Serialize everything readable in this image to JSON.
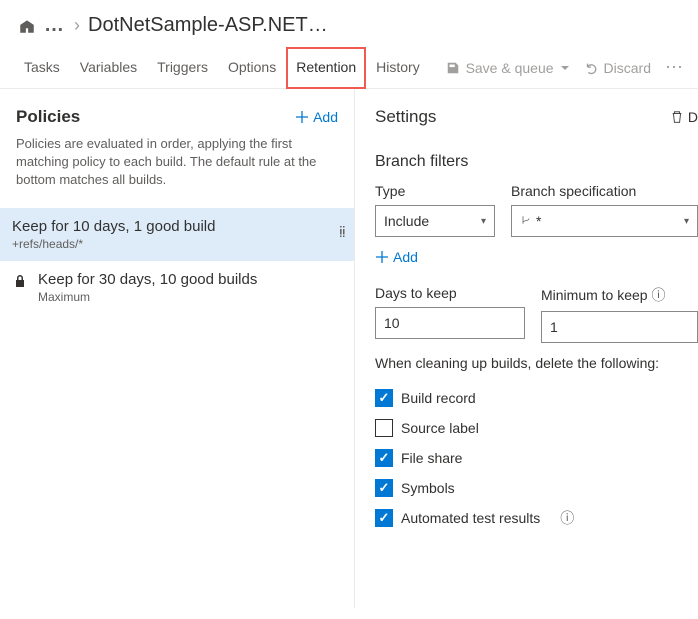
{
  "breadcrumb": {
    "ellipsis": "…",
    "title": "DotNetSample-ASP.NET…"
  },
  "tabs": {
    "tasks": "Tasks",
    "variables": "Variables",
    "triggers": "Triggers",
    "options": "Options",
    "retention": "Retention",
    "history": "History"
  },
  "toolbar": {
    "save_queue": "Save & queue",
    "discard": "Discard"
  },
  "policies": {
    "heading": "Policies",
    "add": "Add",
    "description": "Policies are evaluated in order, applying the first matching policy to each build. The default rule at the bottom matches all builds.",
    "items": [
      {
        "title": "Keep for 10 days, 1 good build",
        "sub": "+refs/heads/*"
      },
      {
        "title": "Keep for 30 days, 10 good builds",
        "sub": "Maximum"
      }
    ]
  },
  "settings": {
    "heading": "Settings",
    "delete_label": "D",
    "branch_filters": "Branch filters",
    "type_label": "Type",
    "type_value": "Include",
    "branch_spec_label": "Branch specification",
    "branch_spec_value": "*",
    "add": "Add",
    "days_label": "Days to keep",
    "days_value": "10",
    "min_label": "Minimum to keep",
    "min_value": "1",
    "cleanup": "When cleaning up builds, delete the following:",
    "checks": {
      "build_record": "Build record",
      "source_label": "Source label",
      "file_share": "File share",
      "symbols": "Symbols",
      "automated": "Automated test results"
    }
  }
}
